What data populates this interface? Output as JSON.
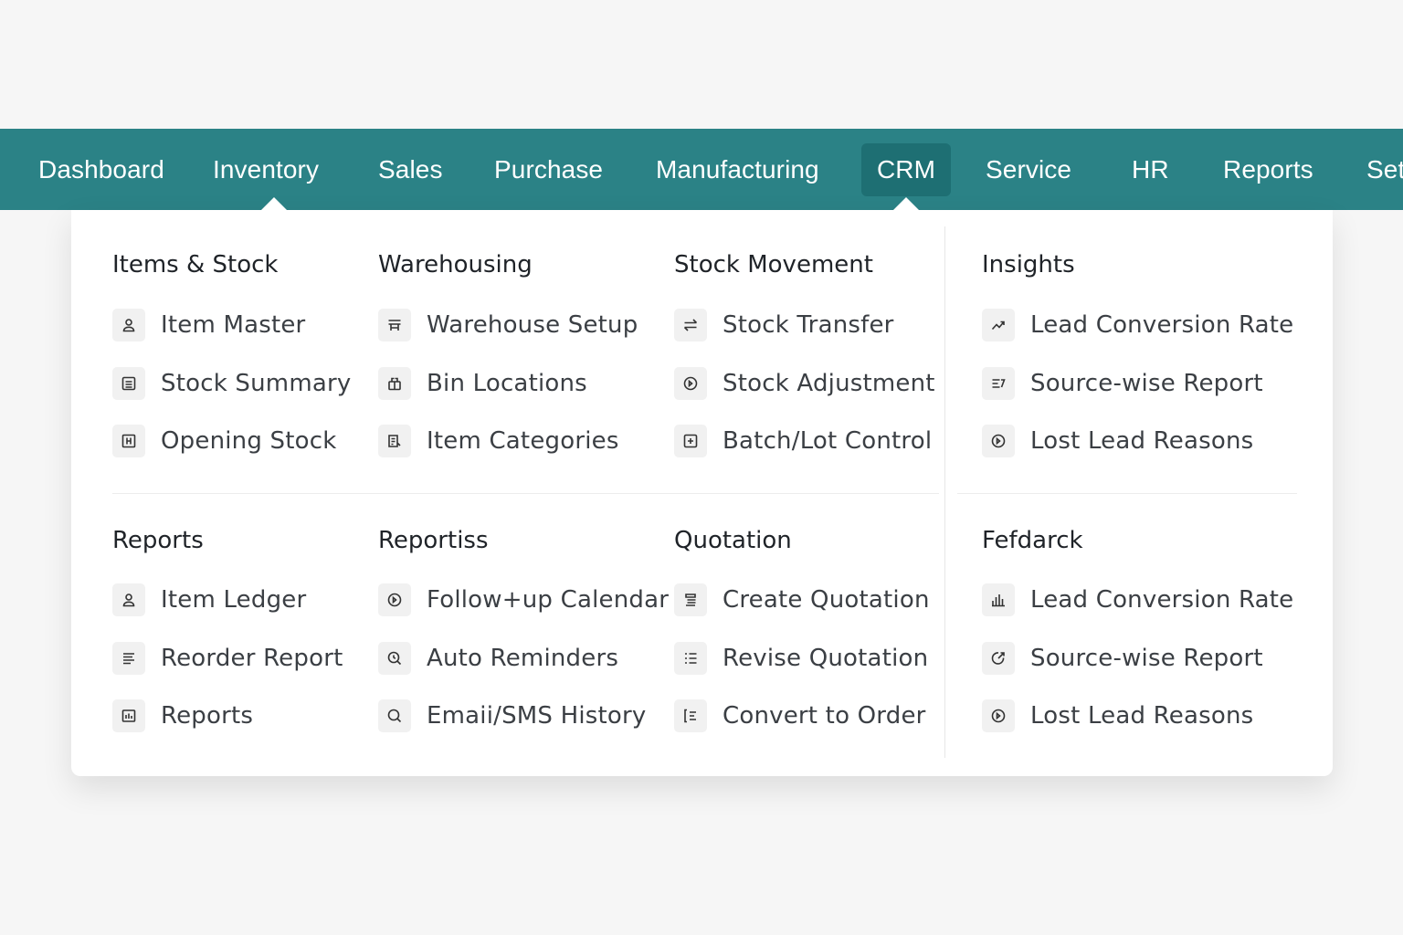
{
  "nav": {
    "items": [
      "Dashboard",
      "Inventory",
      "Sales",
      "Purchase",
      "Manufacturing",
      "CRM",
      "Service",
      "HR",
      "Reports",
      "Set"
    ],
    "active": "CRM"
  },
  "colors": {
    "nav_bg": "#2b8286",
    "nav_active_bg": "#1e6f73",
    "panel_bg": "#ffffff",
    "page_bg": "#f6f6f6"
  },
  "menu": {
    "sections": [
      {
        "heading": "Items & Stock",
        "items": [
          {
            "label": "Item Master",
            "icon": "user-icon"
          },
          {
            "label": "Stock Summary",
            "icon": "document-icon"
          },
          {
            "label": "Opening Stock",
            "icon": "grid-box-icon"
          }
        ]
      },
      {
        "heading": "Warehousing",
        "items": [
          {
            "label": "Warehouse Setup",
            "icon": "warehouse-icon"
          },
          {
            "label": "Bin Locations",
            "icon": "boxes-icon"
          },
          {
            "label": "Item Categories",
            "icon": "list-edit-icon"
          }
        ]
      },
      {
        "heading": "Stock Movement",
        "items": [
          {
            "label": "Stock Transfer",
            "icon": "transfer-arrows-icon"
          },
          {
            "label": "Stock Adjustment",
            "icon": "circle-play-icon"
          },
          {
            "label": "Batch/Lot Control",
            "icon": "plus-box-icon"
          }
        ]
      },
      {
        "heading": "Insights",
        "items": [
          {
            "label": "Lead Conversion Rate",
            "icon": "trend-up-icon"
          },
          {
            "label": "Source-wise Report",
            "icon": "sort-lines-icon"
          },
          {
            "label": "Lost Lead Reasons",
            "icon": "circle-play-icon"
          }
        ]
      },
      {
        "heading": "Reports",
        "items": [
          {
            "label": "Item Ledger",
            "icon": "user-icon"
          },
          {
            "label": "Reorder Report",
            "icon": "lines-icon"
          },
          {
            "label": "Reports",
            "icon": "bar-box-icon"
          }
        ]
      },
      {
        "heading": "Reportiss",
        "items": [
          {
            "label": "Follow+up Calendar",
            "icon": "circle-play-icon"
          },
          {
            "label": "Auto Reminders",
            "icon": "search-clock-icon"
          },
          {
            "label": "Emaii/SMS History",
            "icon": "search-icon"
          }
        ]
      },
      {
        "heading": "Quotation",
        "items": [
          {
            "label": "Create Quotation",
            "icon": "doc-lines-icon"
          },
          {
            "label": "Revise Quotation",
            "icon": "checklist-icon"
          },
          {
            "label": "Convert to Order",
            "icon": "bracket-list-icon"
          }
        ]
      },
      {
        "heading": "Fefdarck",
        "items": [
          {
            "label": "Lead Conversion Rate",
            "icon": "bar-chart-icon"
          },
          {
            "label": "Source-wise Report",
            "icon": "circle-arrow-icon"
          },
          {
            "label": "Lost Lead Reasons",
            "icon": "circle-play-icon"
          }
        ]
      }
    ]
  }
}
